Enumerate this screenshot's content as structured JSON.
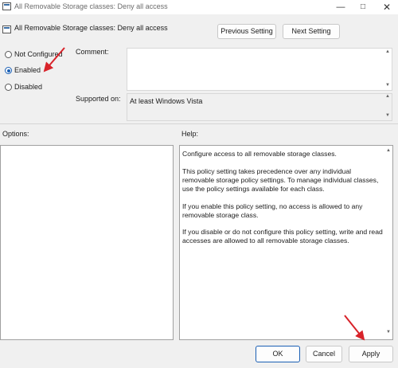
{
  "window": {
    "title": "All Removable Storage classes: Deny all access",
    "controls": {
      "minimize": "—",
      "maximize": "□",
      "close": "✕"
    }
  },
  "policy_title": "All Removable Storage classes: Deny all access",
  "nav": {
    "prev": "Previous Setting",
    "next": "Next Setting"
  },
  "options": {
    "not_configured": "Not Configured",
    "enabled": "Enabled",
    "disabled": "Disabled",
    "selected": "Enabled"
  },
  "comment_label": "Comment:",
  "comment_value": "",
  "supported_label": "Supported on:",
  "supported_value": "At least Windows Vista",
  "options_label": "Options:",
  "help_label": "Help:",
  "help_paragraphs": [
    "Configure access to all removable storage classes.",
    "This policy setting takes precedence over any individual removable storage policy settings. To manage individual classes, use the policy settings available for each class.",
    "If you enable this policy setting, no access is allowed to any removable storage class.",
    "If you disable or do not configure this policy setting, write and read accesses are allowed to all removable storage classes."
  ],
  "buttons": {
    "ok": "OK",
    "cancel": "Cancel",
    "apply": "Apply"
  },
  "icons": {
    "scroll_up": "▲",
    "scroll_down": "▼"
  },
  "annotation_color": "#d8232a"
}
